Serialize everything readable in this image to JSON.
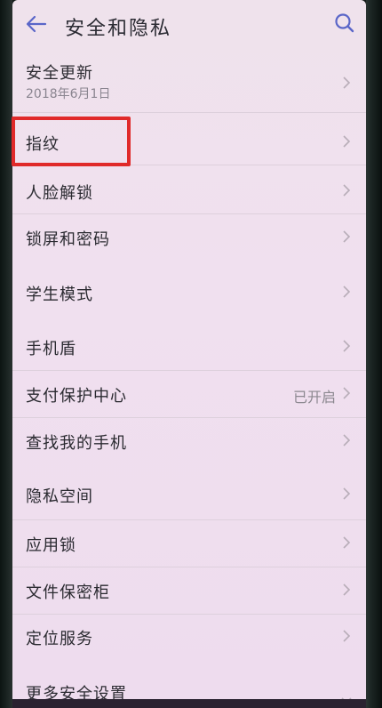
{
  "header": {
    "title": "安全和隐私",
    "back_icon": "back-arrow-icon",
    "search_icon": "search-icon"
  },
  "items": [
    {
      "label": "安全更新",
      "sub": "2018年6月1日",
      "value": ""
    },
    {
      "label": "指纹",
      "sub": "",
      "value": ""
    },
    {
      "label": "人脸解锁",
      "sub": "",
      "value": ""
    },
    {
      "label": "锁屏和密码",
      "sub": "",
      "value": ""
    },
    {
      "label": "学生模式",
      "sub": "",
      "value": ""
    },
    {
      "label": "手机盾",
      "sub": "",
      "value": ""
    },
    {
      "label": "支付保护中心",
      "sub": "",
      "value": "已开启"
    },
    {
      "label": "查找我的手机",
      "sub": "",
      "value": ""
    },
    {
      "label": "隐私空间",
      "sub": "",
      "value": ""
    },
    {
      "label": "应用锁",
      "sub": "",
      "value": ""
    },
    {
      "label": "文件保密柜",
      "sub": "",
      "value": ""
    },
    {
      "label": "定位服务",
      "sub": "",
      "value": ""
    },
    {
      "label": "更多安全设置",
      "sub": "",
      "value": ""
    }
  ],
  "colors": {
    "accent": "#5a66c8",
    "highlight": "#e02a2a",
    "background": "#f0e0ef"
  }
}
